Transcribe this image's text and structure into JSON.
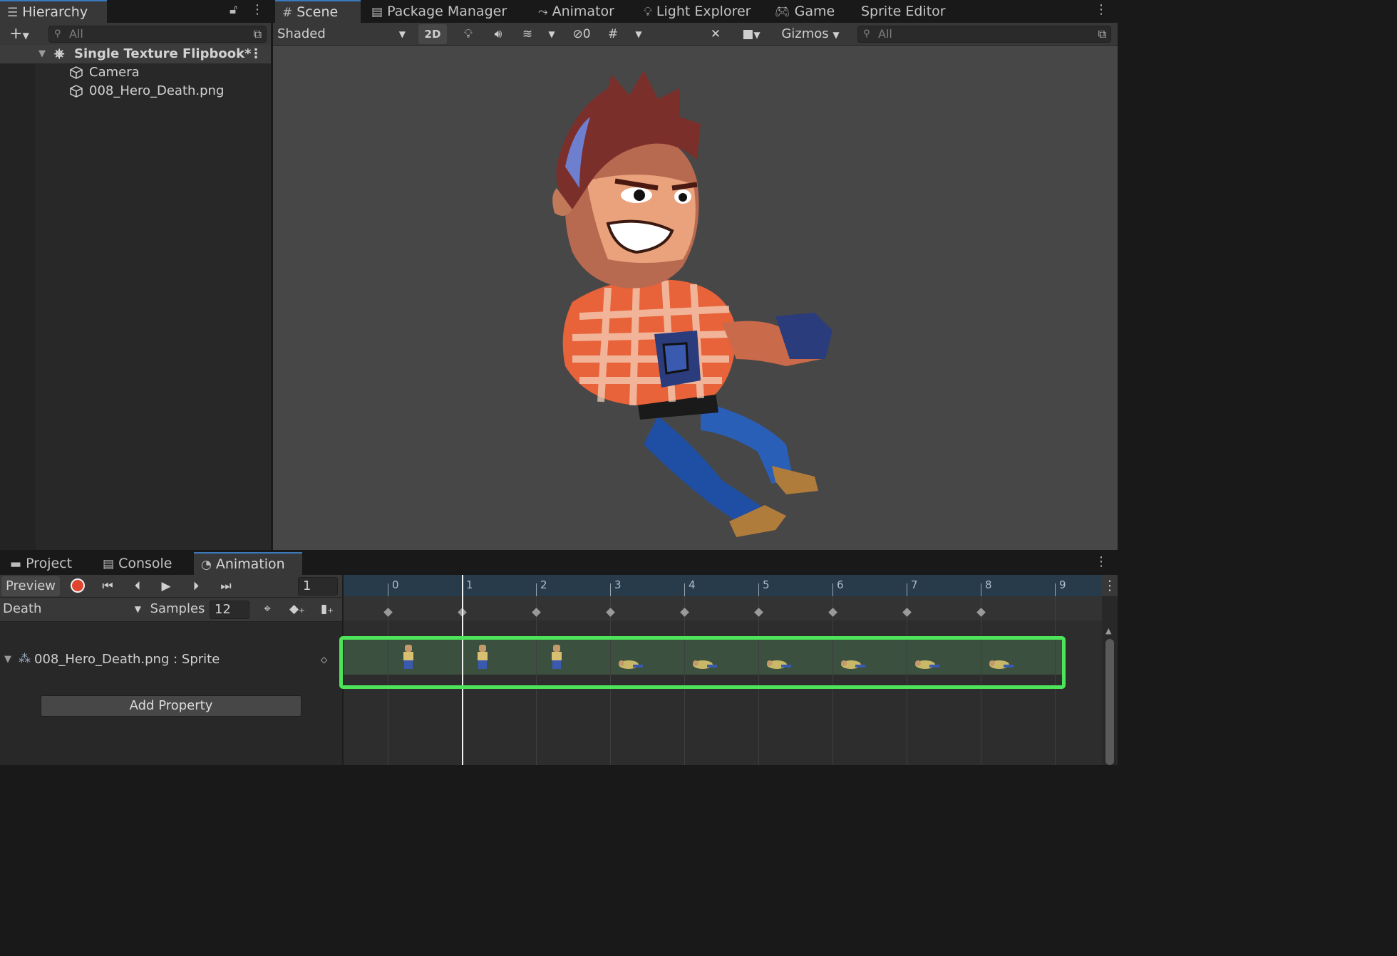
{
  "hierarchy": {
    "tab_label": "Hierarchy",
    "search_placeholder": "All",
    "scene_name": "Single Texture Flipbook*",
    "items": [
      {
        "label": "Camera"
      },
      {
        "label": "008_Hero_Death.png"
      }
    ]
  },
  "scene": {
    "tabs": [
      {
        "label": "Scene",
        "icon": "grid-icon"
      },
      {
        "label": "Package Manager",
        "icon": "package-icon"
      },
      {
        "label": "Animator",
        "icon": "animator-icon"
      },
      {
        "label": "Light Explorer",
        "icon": "light-icon"
      },
      {
        "label": "Game",
        "icon": "gamepad-icon"
      },
      {
        "label": "Sprite Editor",
        "icon": ""
      }
    ],
    "toolbar": {
      "shading_mode": "Shaded",
      "mode_2d": "2D",
      "hidden_count": "0",
      "gizmos": "Gizmos",
      "search_placeholder": "All"
    },
    "colors": {
      "background": "#474747"
    }
  },
  "animation": {
    "tabs": [
      {
        "label": "Project",
        "icon": "folder-icon"
      },
      {
        "label": "Console",
        "icon": "console-icon"
      },
      {
        "label": "Animation",
        "icon": "clock-icon"
      }
    ],
    "preview_label": "Preview",
    "frame_value": "1",
    "clip_name": "Death",
    "samples_label": "Samples",
    "samples_value": "12",
    "timeline_labels": [
      "0",
      "1",
      "2",
      "3",
      "4",
      "5",
      "6",
      "7",
      "8",
      "9"
    ],
    "current_frame": 1,
    "property_label": "008_Hero_Death.png : Sprite",
    "add_property": "Add Property",
    "keyframe_count": 9,
    "highlight_color": "#4de45a"
  }
}
